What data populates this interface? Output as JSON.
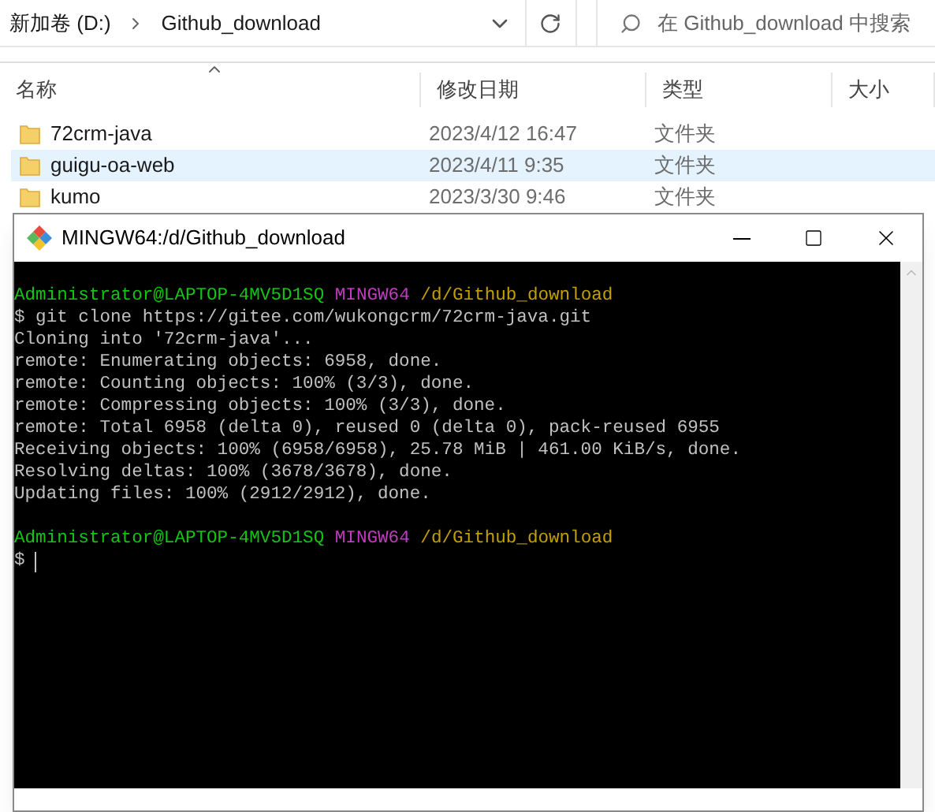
{
  "explorer": {
    "breadcrumb": [
      "新加卷 (D:)",
      "Github_download"
    ],
    "search": {
      "placeholder": "在 Github_download 中搜索"
    },
    "columns": [
      "名称",
      "修改日期",
      "类型",
      "大小"
    ],
    "rows": [
      {
        "name": "72crm-java",
        "modified": "2023/4/12 16:47",
        "type": "文件夹",
        "selected": false
      },
      {
        "name": "guigu-oa-web",
        "modified": "2023/4/11 9:35",
        "type": "文件夹",
        "selected": true
      },
      {
        "name": "kumo",
        "modified": "2023/3/30 9:46",
        "type": "文件夹",
        "selected": false
      }
    ]
  },
  "terminal": {
    "title": "MINGW64:/d/Github_download",
    "lines": [
      {
        "kind": "prompt",
        "parts": [
          {
            "text": "Administrator@LAPTOP-4MV5D1SQ",
            "color": "#13c513"
          },
          {
            "text": "MINGW64",
            "color": "#c33ac3"
          },
          {
            "text": "/d/Github_download",
            "color": "#c0a000"
          }
        ]
      },
      {
        "kind": "output",
        "text": "$ git clone https://gitee.com/wukongcrm/72crm-java.git"
      },
      {
        "kind": "output",
        "text": "Cloning into '72crm-java'..."
      },
      {
        "kind": "output",
        "text": "remote: Enumerating objects: 6958, done."
      },
      {
        "kind": "output",
        "text": "remote: Counting objects: 100% (3/3), done."
      },
      {
        "kind": "output",
        "text": "remote: Compressing objects: 100% (3/3), done."
      },
      {
        "kind": "output",
        "text": "remote: Total 6958 (delta 0), reused 0 (delta 0), pack-reused 6955"
      },
      {
        "kind": "output",
        "text": "Receiving objects: 100% (6958/6958), 25.78 MiB | 461.00 KiB/s, done."
      },
      {
        "kind": "output",
        "text": "Resolving deltas: 100% (3678/3678), done."
      },
      {
        "kind": "output",
        "text": "Updating files: 100% (2912/2912), done."
      },
      {
        "kind": "blank"
      },
      {
        "kind": "prompt",
        "parts": [
          {
            "text": "Administrator@LAPTOP-4MV5D1SQ",
            "color": "#13c513"
          },
          {
            "text": "MINGW64",
            "color": "#c33ac3"
          },
          {
            "text": "/d/Github_download",
            "color": "#c0a000"
          }
        ]
      },
      {
        "kind": "input",
        "text": "$"
      }
    ]
  }
}
